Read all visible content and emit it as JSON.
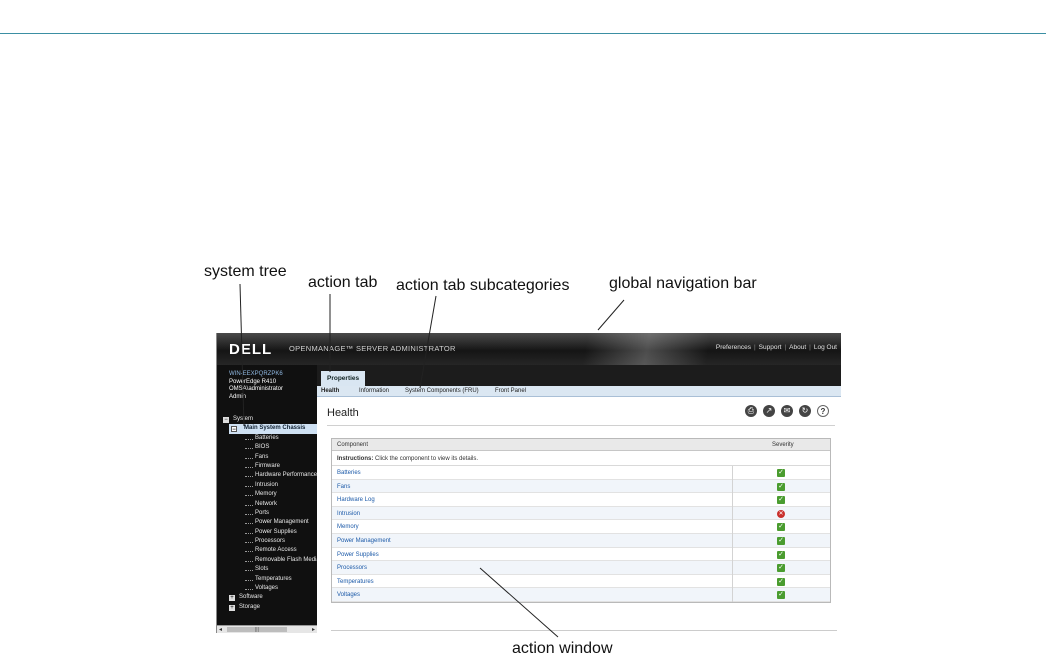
{
  "callouts": {
    "system_tree": "system tree",
    "action_tab": "action tab",
    "action_tab_subcategories": "action tab subcategories",
    "global_navigation_bar": "global navigation bar",
    "action_window": "action window"
  },
  "header": {
    "logo": "DELL",
    "product": "OPENMANAGE™ SERVER ADMINISTRATOR",
    "nav": [
      "Preferences",
      "Support",
      "About",
      "Log Out"
    ]
  },
  "host": {
    "hostname": "WIN-EEXPQRZPK6",
    "model": "PowerEdge R410",
    "user": "OMSA\\administrator",
    "role": "Admin"
  },
  "tree": {
    "root": "System",
    "chassis": "Main System Chassis",
    "children": [
      "Batteries",
      "BIOS",
      "Fans",
      "Firmware",
      "Hardware Performance",
      "Intrusion",
      "Memory",
      "Network",
      "Ports",
      "Power Management",
      "Power Supplies",
      "Processors",
      "Remote Access",
      "Removable Flash Media",
      "Slots",
      "Temperatures",
      "Voltages"
    ],
    "groups": [
      "Software",
      "Storage"
    ]
  },
  "tabs": {
    "action_tab": "Properties",
    "subtabs": [
      "Health",
      "Information",
      "System Components (FRU)",
      "Front Panel"
    ]
  },
  "page": {
    "title": "Health",
    "tools": [
      "print-icon",
      "export-icon",
      "email-icon",
      "refresh-icon",
      "help-icon"
    ]
  },
  "grid": {
    "col_component": "Component",
    "col_severity": "Severity",
    "instructions_label": "Instructions:",
    "instructions_text": "Click the component to view its details.",
    "rows": [
      {
        "component": "Batteries",
        "severity": "ok"
      },
      {
        "component": "Fans",
        "severity": "ok"
      },
      {
        "component": "Hardware Log",
        "severity": "ok"
      },
      {
        "component": "Intrusion",
        "severity": "critical"
      },
      {
        "component": "Memory",
        "severity": "ok"
      },
      {
        "component": "Power Management",
        "severity": "ok"
      },
      {
        "component": "Power Supplies",
        "severity": "ok"
      },
      {
        "component": "Processors",
        "severity": "ok"
      },
      {
        "component": "Temperatures",
        "severity": "ok"
      },
      {
        "component": "Voltages",
        "severity": "ok"
      }
    ]
  },
  "colors": {
    "ok": "#4a9c2f",
    "critical": "#c9302c",
    "link": "#1c5aa8",
    "tab_highlight": "#d9e6f2"
  }
}
